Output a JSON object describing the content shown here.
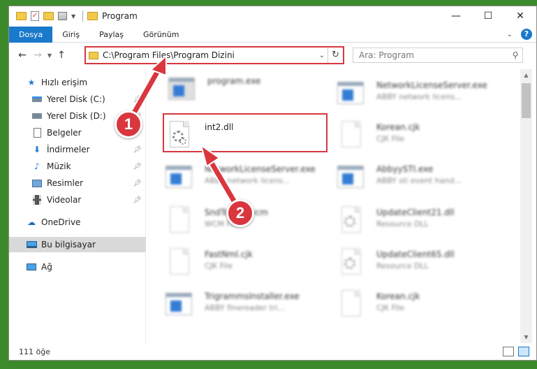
{
  "window": {
    "title": "Program"
  },
  "ribbon": {
    "tabs": [
      "Dosya",
      "Giriş",
      "Paylaş",
      "Görünüm"
    ]
  },
  "address": {
    "path": "C:\\Program Files\\Program Dizini"
  },
  "search": {
    "placeholder": "Ara: Program"
  },
  "navpane": {
    "items": [
      {
        "label": "Hızlı erişim",
        "icon": "star-icon"
      },
      {
        "label": "Yerel Disk (C:)",
        "icon": "drive-icon"
      },
      {
        "label": "Yerel Disk (D:)",
        "icon": "drive-icon"
      },
      {
        "label": "Belgeler",
        "icon": "documents-icon"
      },
      {
        "label": "İndirmeler",
        "icon": "download-icon"
      },
      {
        "label": "Müzik",
        "icon": "music-icon"
      },
      {
        "label": "Resimler",
        "icon": "pictures-icon"
      },
      {
        "label": "Videolar",
        "icon": "videos-icon"
      },
      {
        "label": "OneDrive",
        "icon": "cloud-icon"
      },
      {
        "label": "Bu bilgisayar",
        "icon": "computer-icon"
      },
      {
        "label": "Ağ",
        "icon": "network-icon"
      }
    ]
  },
  "files": {
    "left": [
      {
        "name": "program.exe",
        "desc": ""
      },
      {
        "name": "int2.dll",
        "desc": ""
      },
      {
        "name": "NetworkLicenseServer.exe",
        "desc": "ABBY network licens..."
      },
      {
        "name": "SndToWeb.vcm",
        "desc": "WCM File"
      },
      {
        "name": "FastNml.cjk",
        "desc": "CJK File"
      },
      {
        "name": "TrigrammsInstaller.exe",
        "desc": "ABBY finereader tri..."
      }
    ],
    "right": [
      {
        "name": "NetworkLicenseServer.exe",
        "desc": "ABBY network licens..."
      },
      {
        "name": "Korean.cjk",
        "desc": "CJK File"
      },
      {
        "name": "AbbyySTI.exe",
        "desc": "ABBY sti event hand..."
      },
      {
        "name": "UpdateClient21.dll",
        "desc": "Resource DLL"
      },
      {
        "name": "UpdateClient65.dll",
        "desc": "Resource DLL"
      },
      {
        "name": "Korean.cjk",
        "desc": "CJK File"
      }
    ]
  },
  "status": {
    "count": "111 öğe"
  },
  "annotations": {
    "step1": "1",
    "step2": "2",
    "color": "#d9363e"
  }
}
